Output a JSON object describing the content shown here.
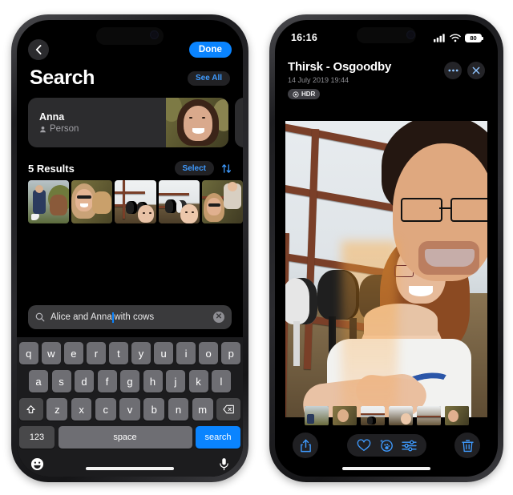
{
  "left_phone": {
    "nav": {
      "back_icon": "chevron-left-icon",
      "done_label": "Done"
    },
    "header": {
      "title": "Search",
      "see_all_label": "See All"
    },
    "person_card": {
      "name": "Anna",
      "subtitle": "Person",
      "person_icon": "person-icon"
    },
    "results": {
      "count_label": "5 Results",
      "select_label": "Select",
      "sort_icon": "sort-arrows-icon",
      "thumbnails": [
        {
          "alt": "person holding child beside cow"
        },
        {
          "alt": "woman with sunglasses and cow"
        },
        {
          "alt": "cows behind gate with baby"
        },
        {
          "alt": "baby and cows at fence"
        },
        {
          "alt": "woman and child at farm gate"
        }
      ]
    },
    "search": {
      "search_icon": "search-icon",
      "value_before_caret": "Alice and Anna",
      "value_after_caret": " with cows",
      "full_value": "Alice and Anna with cows",
      "clear_icon": "clear-circle-icon"
    },
    "keyboard": {
      "row1": [
        "q",
        "w",
        "e",
        "r",
        "t",
        "y",
        "u",
        "i",
        "o",
        "p"
      ],
      "row2": [
        "a",
        "s",
        "d",
        "f",
        "g",
        "h",
        "j",
        "k",
        "l"
      ],
      "row3": [
        "z",
        "x",
        "c",
        "v",
        "b",
        "n",
        "m"
      ],
      "shift_icon": "shift-arrow-icon",
      "backspace_icon": "backspace-icon",
      "numbers_label": "123",
      "space_label": "space",
      "return_label": "search",
      "emoji_icon": "emoji-smiley-icon",
      "dictation_icon": "microphone-icon"
    }
  },
  "right_phone": {
    "status_bar": {
      "time": "16:16",
      "cellular_icon": "cellular-bars-icon",
      "wifi_icon": "wifi-icon",
      "battery_level": "80"
    },
    "header": {
      "title": "Thirsk - Osgoodby",
      "date": "14 July 2019  19:44",
      "hdr_badge": "HDR",
      "hdr_icon": "hdr-sun-icon",
      "more_icon": "more-ellipsis-icon",
      "close_icon": "close-x-icon"
    },
    "photo": {
      "alt": "Family selfie at farm gate with cows: man with glasses, woman and baby"
    },
    "filmstrip": [
      {
        "alt": "thumbnail 1"
      },
      {
        "alt": "thumbnail 2"
      },
      {
        "alt": "thumbnail 3"
      },
      {
        "alt": "thumbnail 4"
      },
      {
        "alt": "thumbnail 5"
      },
      {
        "alt": "thumbnail 6"
      }
    ],
    "toolbar": {
      "share_icon": "share-upload-icon",
      "favorite_icon": "heart-icon",
      "lookup_icon": "visual-lookup-paw-icon",
      "adjust_icon": "adjustments-sliders-icon",
      "delete_icon": "trash-icon"
    }
  },
  "colors": {
    "accent_blue": "#0a84ff",
    "tint_blue": "#3f9bff",
    "card_gray": "#2c2c2e",
    "key_gray": "#6e6e73",
    "key_dark": "#48484a",
    "page_bg": "#ffffff"
  }
}
